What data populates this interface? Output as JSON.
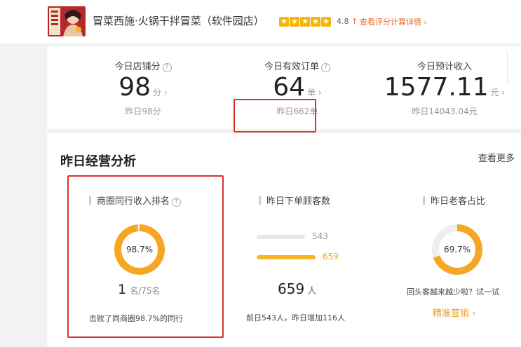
{
  "header": {
    "shop_name": "冒菜西施·火锅干拌冒菜（软件园店）",
    "star_count": 5,
    "rating": "4.8",
    "rating_trend": "↑",
    "detail_link": "查看评分计算详情 ›"
  },
  "stats": [
    {
      "title": "今日店铺分",
      "value": "98",
      "unit": "分 ›",
      "sub": "昨日98分"
    },
    {
      "title": "今日有效订单",
      "value": "64",
      "unit": "单 ›",
      "sub": "昨日662单"
    },
    {
      "title": "今日预计收入",
      "value": "1577.11",
      "unit": "元 ›",
      "sub": "昨日14043.04元"
    }
  ],
  "analysis": {
    "title": "昨日经营分析",
    "more_link": "查看更多",
    "ranking": {
      "title": "商圈同行收入排名",
      "percent_text": "98.7%",
      "percent_value": 98.7,
      "rank": "1",
      "rank_suffix": "名/75名",
      "beat_text": "击败了同商圈98.7%的同行"
    },
    "customers": {
      "title": "昨日下单顾客数",
      "bars": [
        {
          "value": 543,
          "label": "543",
          "color": "#e6e6e6",
          "text_color": "#999999"
        },
        {
          "value": 659,
          "label": "659",
          "color": "#f5b623",
          "text_color": "#f5a623"
        }
      ],
      "total": "659",
      "unit": "人",
      "note": "前日543人，昨日增加116人"
    },
    "repeat": {
      "title": "昨日老客占比",
      "percent_text": "69.7%",
      "percent_value": 69.7,
      "hint": "回头客越来越少啦？试一试",
      "cta": "精准营销 ›"
    }
  },
  "colors": {
    "accent": "#f5a623",
    "highlight": "#e0302b",
    "link": "#e56b2b"
  }
}
